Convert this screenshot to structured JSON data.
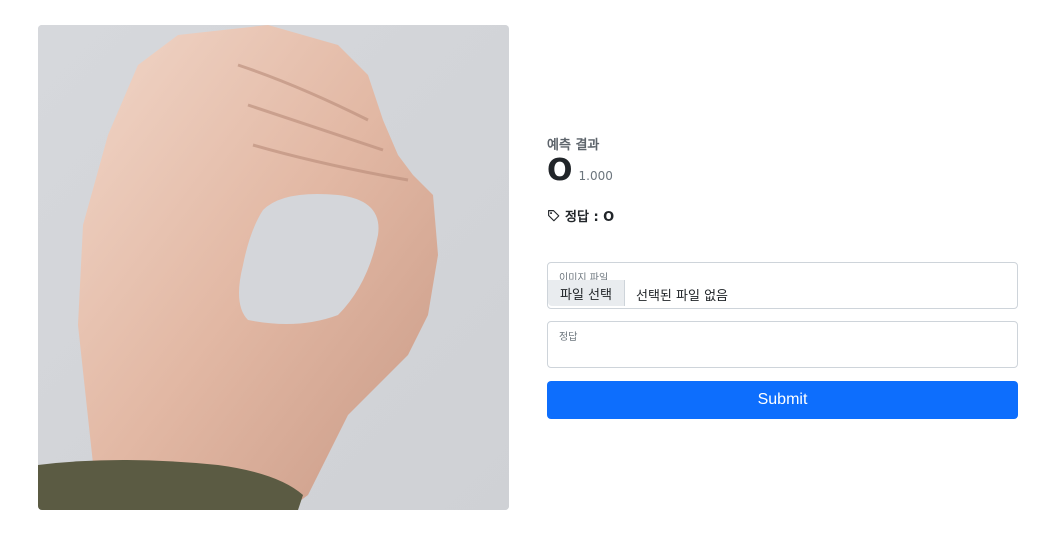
{
  "photo": {
    "alt": "hand sign O"
  },
  "prediction": {
    "label": "예측 결과",
    "letter": "O",
    "confidence": "1.000"
  },
  "answer": {
    "text": "정답 : O",
    "icon": "tag-icon"
  },
  "form": {
    "file_label": "이미지 파일",
    "file_button": "파일 선택",
    "file_status": "선택된 파일 없음",
    "answer_label": "정답",
    "submit_label": "Submit"
  },
  "colors": {
    "primary": "#0d6efd",
    "background": "#d2d4d9"
  }
}
